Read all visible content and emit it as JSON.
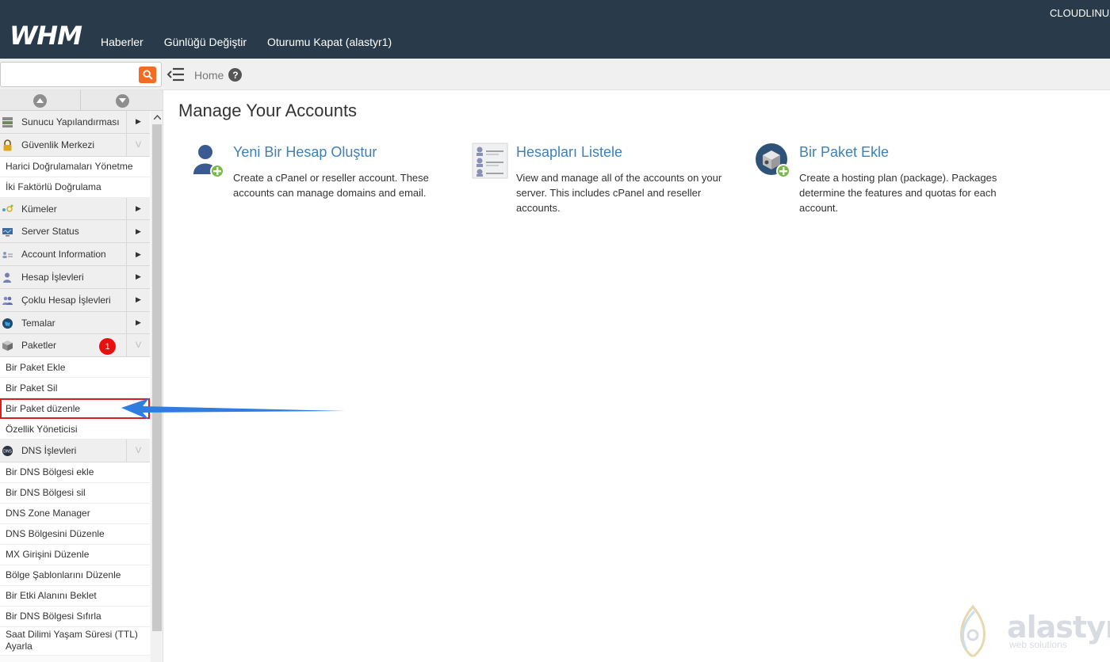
{
  "header": {
    "logo_text": "WHM",
    "nav": [
      "Haberler",
      "Günlüğü Değiştir",
      "Oturumu Kapat (alastyr1)"
    ],
    "right_text": "CLOUDLINUX"
  },
  "search": {
    "value": "",
    "placeholder": ""
  },
  "breadcrumb": {
    "label": "Home",
    "help_icon": "?"
  },
  "sidebar": {
    "sections": [
      {
        "label": "Sunucu Yapılandırması",
        "icon": "server-config-icon",
        "expanded": false,
        "items": []
      },
      {
        "label": "Güvenlik Merkezi",
        "icon": "lock-icon",
        "expanded": true,
        "items": [
          "Harici Doğrulamaları Yönetme",
          "İki Faktörlü Doğrulama"
        ]
      },
      {
        "label": "Kümeler",
        "icon": "cluster-icon",
        "expanded": false,
        "items": []
      },
      {
        "label": "Server Status",
        "icon": "monitor-icon",
        "expanded": false,
        "items": []
      },
      {
        "label": "Account Information",
        "icon": "account-info-icon",
        "expanded": false,
        "items": []
      },
      {
        "label": "Hesap İşlevleri",
        "icon": "user-icon",
        "expanded": false,
        "items": []
      },
      {
        "label": "Çoklu Hesap İşlevleri",
        "icon": "users-icon",
        "expanded": false,
        "items": []
      },
      {
        "label": "Temalar",
        "icon": "globe-icon",
        "expanded": false,
        "items": []
      },
      {
        "label": "Paketler",
        "icon": "package-icon",
        "expanded": true,
        "badge": "1",
        "items": [
          "Bir Paket Ekle",
          "Bir Paket Sil",
          "Bir Paket düzenle",
          "Özellik Yöneticisi"
        ],
        "active_item": "Bir Paket düzenle"
      },
      {
        "label": "DNS İşlevleri",
        "icon": "dns-icon",
        "expanded": true,
        "items": [
          "Bir DNS Bölgesi ekle",
          "Bir DNS Bölgesi sil",
          "DNS Zone Manager",
          "DNS Bölgesini Düzenle",
          "MX Girişini Düzenle",
          "Bölge Şablonlarını Düzenle",
          "Bir Etki Alanını Beklet",
          "Bir DNS Bölgesi Sıfırla",
          "Saat Dilimi Yaşam Süresi (TTL) Ayarla"
        ]
      }
    ]
  },
  "main": {
    "title": "Manage Your Accounts",
    "cards": [
      {
        "title": "Yeni Bir Hesap Oluştur",
        "description": "Create a cPanel or reseller account. These accounts can manage domains and email.",
        "icon": "add-user-icon"
      },
      {
        "title": "Hesapları Listele",
        "description": "View and manage all of the accounts on your server. This includes cPanel and reseller accounts.",
        "icon": "list-accounts-icon"
      },
      {
        "title": "Bir Paket Ekle",
        "description": "Create a hosting plan (package). Packages determine the features and quotas for each account.",
        "icon": "add-package-icon"
      }
    ]
  },
  "watermark": {
    "word": "alastyr",
    "sub": "web solutions"
  },
  "colors": {
    "topbar": "#293a4a",
    "accent_orange": "#f26c23",
    "link_blue": "#3e80b6",
    "highlight_red": "#d91f1f",
    "arrow_blue": "#2f7de1"
  }
}
